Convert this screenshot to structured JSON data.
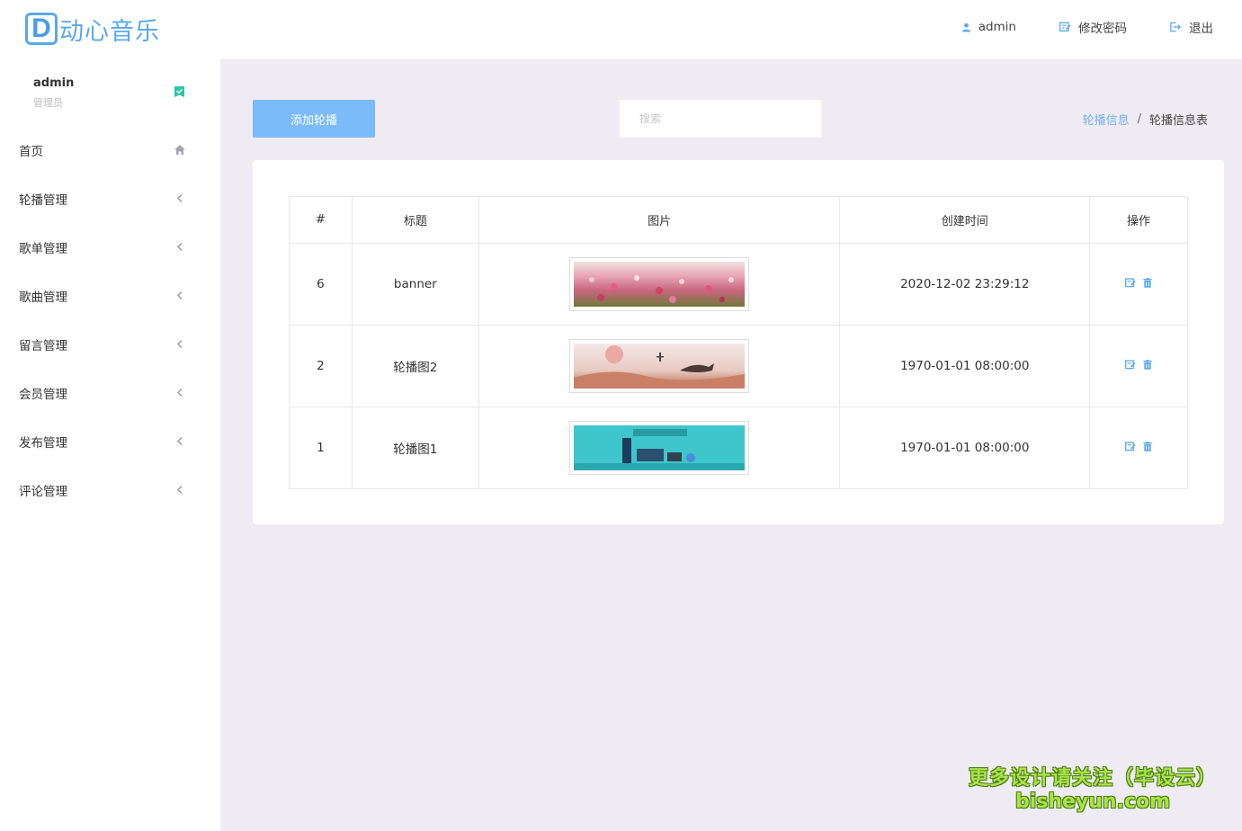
{
  "app": {
    "logo_letter": "D",
    "logo_text": "动心音乐",
    "accent_color": "#5aa9ea"
  },
  "header": {
    "user_label": "admin",
    "change_password_label": "修改密码",
    "logout_label": "退出"
  },
  "sidebar": {
    "user_name": "admin",
    "user_role": "管理员",
    "items": [
      {
        "label": "首页",
        "icon": "home-icon"
      },
      {
        "label": "轮播管理",
        "icon": "chevron-left-icon"
      },
      {
        "label": "歌单管理",
        "icon": "chevron-left-icon"
      },
      {
        "label": "歌曲管理",
        "icon": "chevron-left-icon"
      },
      {
        "label": "留言管理",
        "icon": "chevron-left-icon"
      },
      {
        "label": "会员管理",
        "icon": "chevron-left-icon"
      },
      {
        "label": "发布管理",
        "icon": "chevron-left-icon"
      },
      {
        "label": "评论管理",
        "icon": "chevron-left-icon"
      }
    ]
  },
  "toolbar": {
    "add_label": "添加轮播",
    "search_placeholder": "搜索"
  },
  "breadcrumb": {
    "parent": "轮播信息",
    "separator": "/",
    "current": "轮播信息表"
  },
  "table": {
    "headers": [
      "#",
      "标题",
      "图片",
      "创建时间",
      "操作"
    ],
    "rows": [
      {
        "id": "6",
        "title": "banner",
        "image": "flower-field-banner",
        "created": "2020-12-02 23:29:12"
      },
      {
        "id": "2",
        "title": "轮播图2",
        "image": "whale-poster-banner",
        "created": "1970-01-01 08:00:00"
      },
      {
        "id": "1",
        "title": "轮播图1",
        "image": "product-teal-banner",
        "created": "1970-01-01 08:00:00"
      }
    ]
  },
  "watermark": {
    "line1": "更多设计请关注（毕设云）",
    "line2": "bisheyun.com"
  }
}
